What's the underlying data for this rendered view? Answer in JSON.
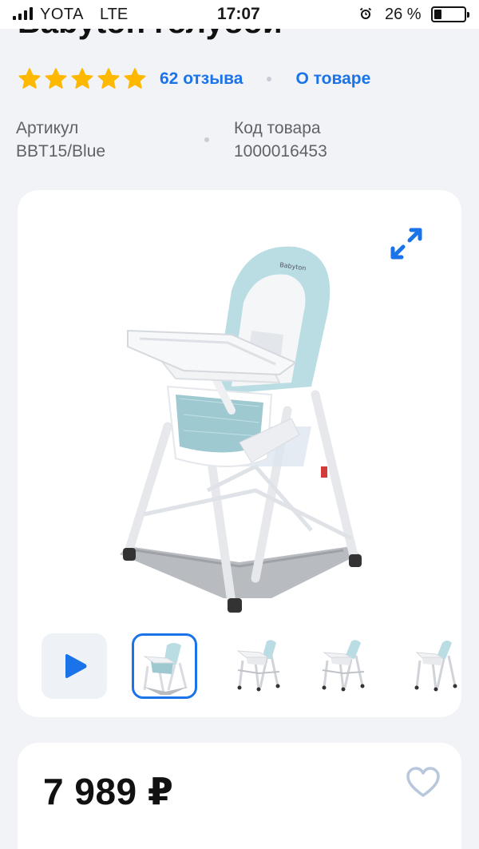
{
  "status_bar": {
    "carrier": "YOTA",
    "network": "LTE",
    "time": "17:07",
    "battery_percent": "26 %",
    "battery_level": 0.26,
    "icons": [
      "signal-icon",
      "alarm-icon",
      "battery-icon"
    ]
  },
  "product": {
    "title_partial": "Babyton голубой",
    "rating_stars": 5,
    "reviews_link": "62 отзыва",
    "about_link": "О товаре",
    "article_label": "Артикул",
    "article_value": "BBT15/Blue",
    "code_label": "Код товара",
    "code_value": "1000016453"
  },
  "gallery": {
    "thumbnails_count": 5,
    "active_thumbnail": 1,
    "icons": [
      "expand-icon",
      "play-icon"
    ]
  },
  "price": {
    "value": "7 989 ₽"
  },
  "colors": {
    "accent": "#1a73e8",
    "star": "#ffb800",
    "background": "#f1f3f6",
    "card": "#ffffff",
    "chair_fabric": "#b9dde3"
  }
}
